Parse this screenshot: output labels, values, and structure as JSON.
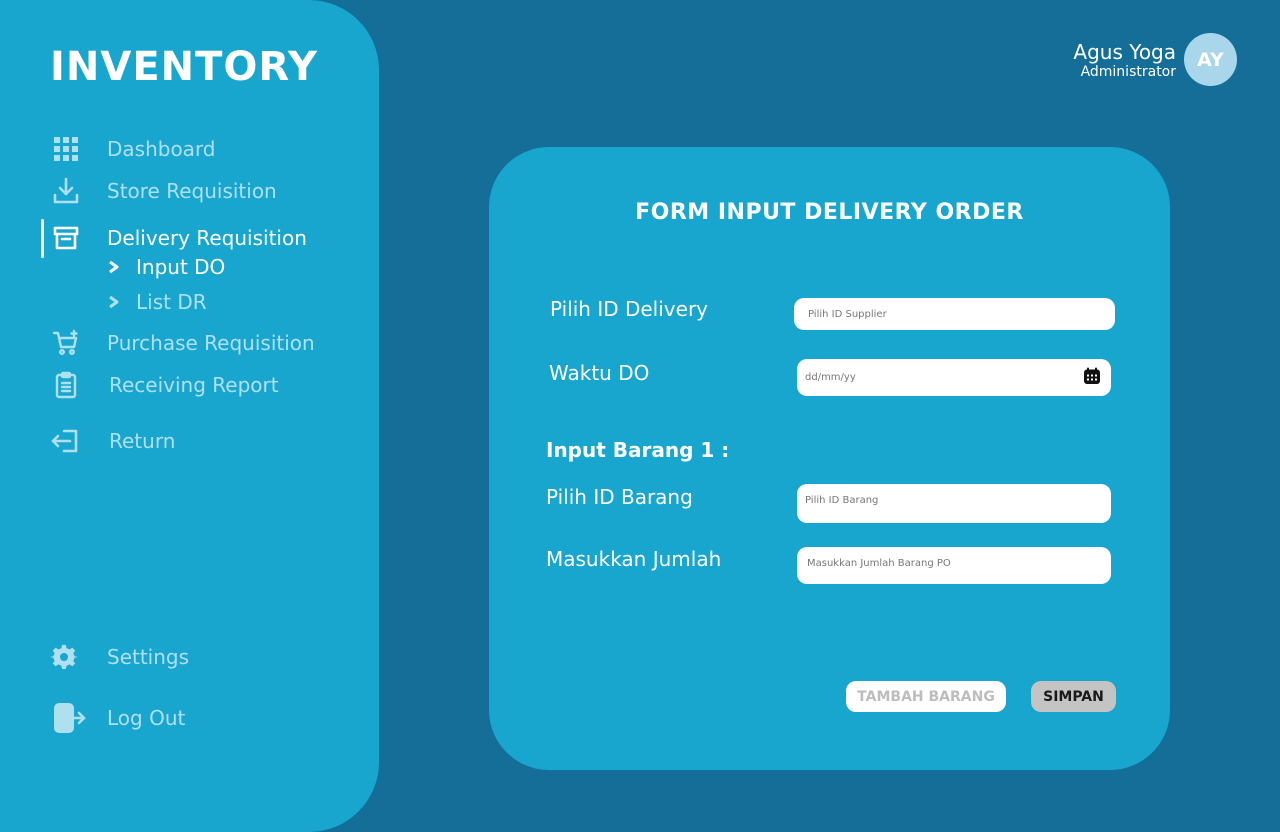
{
  "app": {
    "title": "INVENTORY"
  },
  "sidebar": {
    "items": [
      {
        "label": "Dashboard",
        "icon": "grid-icon"
      },
      {
        "label": "Store Requisition",
        "icon": "download-icon"
      },
      {
        "label": "Delivery Requisition",
        "icon": "archive-box-icon",
        "active": true
      },
      {
        "label": "Purchase Requisition",
        "icon": "cart-icon"
      },
      {
        "label": "Receiving Report",
        "icon": "clipboard-icon"
      },
      {
        "label": "Return",
        "icon": "return-icon"
      },
      {
        "label": "Settings",
        "icon": "gear-icon"
      },
      {
        "label": "Log Out",
        "icon": "logout-icon"
      }
    ],
    "subitems": [
      {
        "label": "Input DO",
        "active": true
      },
      {
        "label": "List DR"
      }
    ]
  },
  "user": {
    "name": "Agus Yoga",
    "role": "Administrator",
    "initials": "AY"
  },
  "form": {
    "title": "FORM INPUT DELIVERY ORDER",
    "delivery": {
      "label": "Pilih ID Delivery",
      "placeholder": "Pilih ID Supplier"
    },
    "waktu": {
      "label": "Waktu DO",
      "placeholder": "dd/mm/yy"
    },
    "section": "Input Barang 1 :",
    "barang": {
      "label": "Pilih ID Barang",
      "placeholder": "Pilih ID Barang"
    },
    "jumlah": {
      "label": "Masukkan Jumlah",
      "placeholder": "Masukkan Jumlah Barang PO"
    },
    "tambah_label": "TAMBAH BARANG",
    "simpan_label": "SIMPAN"
  },
  "colors": {
    "background": "#146e98",
    "panel": "#18a6cf",
    "nav_inactive": "#aee0f0",
    "avatar": "#a9d6ea"
  }
}
